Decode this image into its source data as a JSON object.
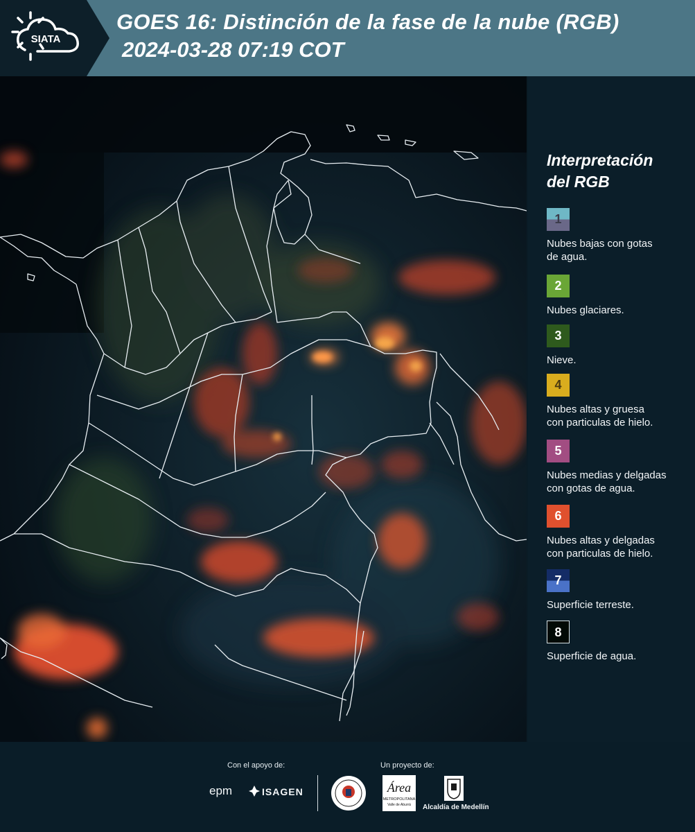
{
  "header": {
    "brand": "SIATA",
    "title_line1": "GOES 16: Distinción de la fase de la nube (RGB)",
    "title_line2": "2024-03-28 07:19 COT"
  },
  "legend": {
    "title_line1": "Interpretación",
    "title_line2": "del RGB",
    "items": [
      {
        "number": "1",
        "label_line1": "Nubes bajas con gotas",
        "label_line2": "de agua.",
        "color_top": "#6fb8c6",
        "color_bottom": "#6a6888"
      },
      {
        "number": "2",
        "label_line1": "Nubes glaciares.",
        "label_line2": "",
        "color_top": "#6aa636",
        "color_bottom": "#6aa636"
      },
      {
        "number": "3",
        "label_line1": "Nieve.",
        "label_line2": "",
        "color_top": "#2e5a1d",
        "color_bottom": "#2e5a1d"
      },
      {
        "number": "4",
        "label_line1": "Nubes altas y gruesa",
        "label_line2": "con particulas de hielo.",
        "color_top": "#d9ad1e",
        "color_bottom": "#d9ad1e"
      },
      {
        "number": "5",
        "label_line1": "Nubes medias y delgadas",
        "label_line2": "con gotas de agua.",
        "color_top": "#a24d82",
        "color_bottom": "#a24d82"
      },
      {
        "number": "6",
        "label_line1": "Nubes altas y delgadas",
        "label_line2": "con particulas de hielo.",
        "color_top": "#e0502e",
        "color_bottom": "#e0502e"
      },
      {
        "number": "7",
        "label_line1": "Superficie terreste.",
        "label_line2": "",
        "color_top": "#142c66",
        "color_bottom": "#4a72c8"
      },
      {
        "number": "8",
        "label_line1": "Superficie de agua.",
        "label_line2": "",
        "color_top": "#020a06",
        "color_bottom": "#020a06"
      }
    ]
  },
  "footer": {
    "support_label": "Con el apoyo de:",
    "project_label": "Un proyecto de:",
    "sponsor_1": "epm",
    "sponsor_2": "ISAGEN",
    "partner_2_line1": "Área",
    "partner_2_line2": "METROPOLITANA",
    "partner_2_line3": "Valle de Aburrá",
    "partner_3": "Alcaldía de Medellín"
  },
  "colors": {
    "header_band": "#4c7686",
    "background": "#0a1c26",
    "cloud_ice": "#e0502e",
    "cloud_thick": "#d9ad1e"
  }
}
